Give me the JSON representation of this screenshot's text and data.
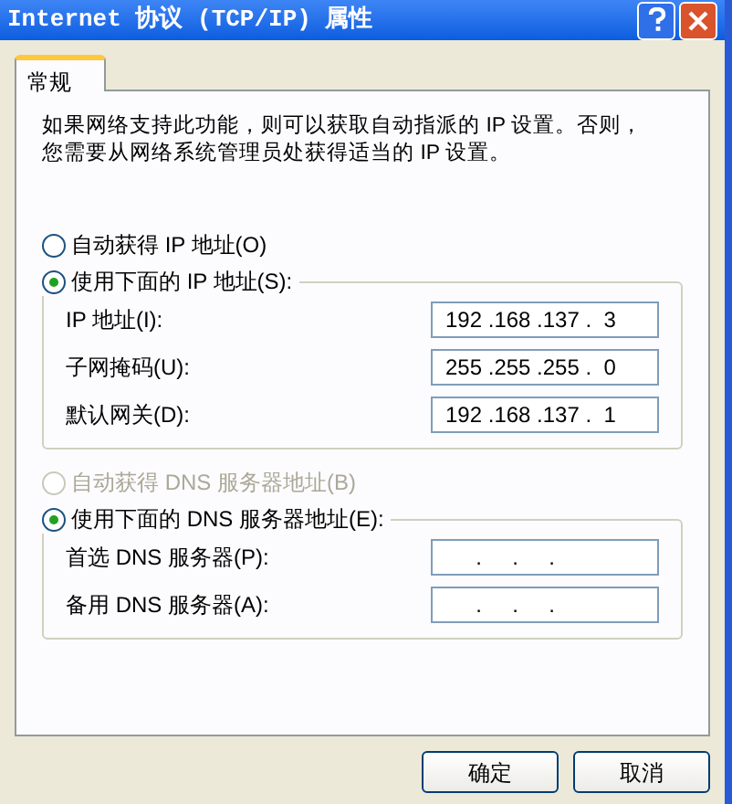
{
  "window": {
    "title": "Internet 协议 (TCP/IP) 属性"
  },
  "tabs": [
    {
      "label": "常规",
      "selected": true
    }
  ],
  "description_lines": [
    "如果网络支持此功能，则可以获取自动指派的 IP 设置。否则，",
    "您需要从网络系统管理员处获得适当的 IP 设置。"
  ],
  "ip_options": [
    {
      "label": "自动获得 IP 地址(O)",
      "selected": false,
      "disabled": false
    },
    {
      "label": "使用下面的 IP 地址(S):",
      "selected": true,
      "disabled": false
    }
  ],
  "ip_fields": [
    {
      "label": "IP 地址(I):",
      "value": "192 .168 .137 .  3"
    },
    {
      "label": "子网掩码(U):",
      "value": "255 .255 .255 .  0"
    },
    {
      "label": "默认网关(D):",
      "value": "192 .168 .137 .  1"
    }
  ],
  "dns_options": [
    {
      "label": "自动获得 DNS 服务器地址(B)",
      "selected": false,
      "disabled": true
    },
    {
      "label": "使用下面的 DNS 服务器地址(E):",
      "selected": true,
      "disabled": false
    }
  ],
  "dns_fields": [
    {
      "label": "首选 DNS 服务器(P):",
      "value": "     .     .     ."
    },
    {
      "label": "备用 DNS 服务器(A):",
      "value": "     .     .     ."
    }
  ],
  "buttons": [
    "确定",
    "取消"
  ]
}
